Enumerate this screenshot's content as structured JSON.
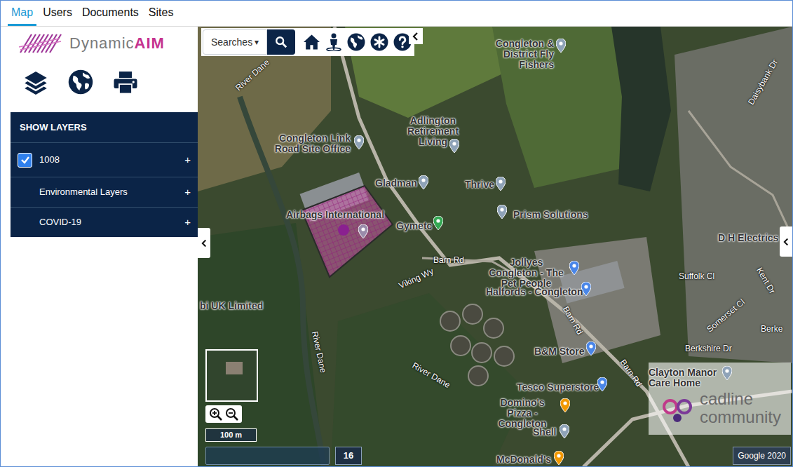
{
  "tabs": [
    {
      "label": "Map",
      "selected": true
    },
    {
      "label": "Users",
      "selected": false
    },
    {
      "label": "Documents",
      "selected": false
    },
    {
      "label": "Sites",
      "selected": false
    }
  ],
  "logo": {
    "part1": "Dynamic",
    "part2": "AIM"
  },
  "layers": {
    "header": "SHOW LAYERS",
    "items": [
      {
        "label": "1008",
        "kind": "checkbox",
        "checked": true,
        "expand": "+"
      },
      {
        "label": "Environmental Layers",
        "kind": "group",
        "expand": "+"
      },
      {
        "label": "COVID-19",
        "kind": "group",
        "expand": "+"
      }
    ]
  },
  "toolbar": {
    "search_label": "Searches",
    "caret": "▾"
  },
  "map": {
    "labels": [
      {
        "text": "Congleton & District Fly Fishers",
        "kind": "place",
        "color": "#8fa3b8"
      },
      {
        "text": "Congleton Link Road Site Office",
        "kind": "place",
        "color": "#8fa3b8"
      },
      {
        "text": "Adlington Retirement Living",
        "kind": "place",
        "color": "#8fa3b8"
      },
      {
        "text": "Gladman",
        "kind": "place",
        "color": "#8fa3b8"
      },
      {
        "text": "Thrive",
        "kind": "place",
        "color": "#8fa3b8"
      },
      {
        "text": "Prism Solutions",
        "kind": "place",
        "color": "#8fa3b8"
      },
      {
        "text": "Airbags International",
        "kind": "place",
        "color": "#9a8cab"
      },
      {
        "text": "Gymetc",
        "kind": "place",
        "color": "#34a853"
      },
      {
        "text": "Jollyes Congleton - The Pet People",
        "kind": "place",
        "color": "#4a86e8"
      },
      {
        "text": "Halfords - Congleton",
        "kind": "place",
        "color": "#4a86e8"
      },
      {
        "text": "D H Electrics",
        "kind": "label"
      },
      {
        "text": "B&M Store",
        "kind": "place",
        "color": "#4a86e8"
      },
      {
        "text": "Tesco Superstore",
        "kind": "place",
        "color": "#4a86e8"
      },
      {
        "text": "Domino's Pizza - Congleton",
        "kind": "place",
        "color": "#f29900"
      },
      {
        "text": "Shell",
        "kind": "place",
        "color": "#8fa3b8"
      },
      {
        "text": "McDonald's",
        "kind": "place",
        "color": "#f29900"
      },
      {
        "text": "Clayton Manor Care Home",
        "kind": "place",
        "color": "#8fa3b8"
      },
      {
        "text": "bi UK Limited",
        "kind": "label"
      },
      {
        "text": "River Dane",
        "kind": "road"
      },
      {
        "text": "River Dane",
        "kind": "road"
      },
      {
        "text": "River Dane",
        "kind": "road"
      },
      {
        "text": "Barn Rd",
        "kind": "road"
      },
      {
        "text": "Viking Wy",
        "kind": "road"
      },
      {
        "text": "Barn Rd",
        "kind": "road"
      },
      {
        "text": "Barn Rd",
        "kind": "road"
      },
      {
        "text": "Suffolk Cl",
        "kind": "road"
      },
      {
        "text": "Kent Dr",
        "kind": "road"
      },
      {
        "text": "Somerset Cl",
        "kind": "road"
      },
      {
        "text": "Berkshire Dr",
        "kind": "road"
      },
      {
        "text": "Berke",
        "kind": "road"
      },
      {
        "text": "Daisybank Dr",
        "kind": "road"
      }
    ],
    "scale": "100 m",
    "zoom_level": "16",
    "attribution": "Google 2020",
    "watermark": {
      "line1": "cadline",
      "line2": "community"
    }
  }
}
